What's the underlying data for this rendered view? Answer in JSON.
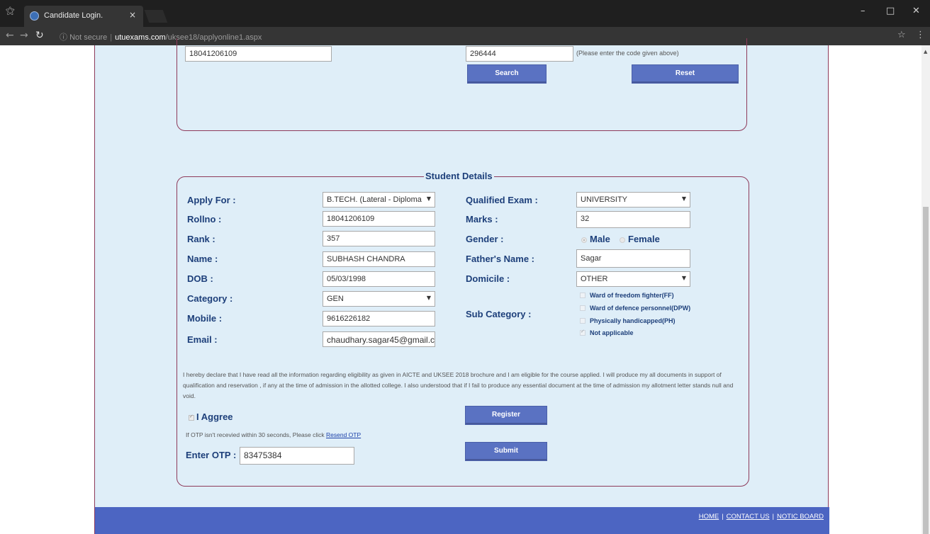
{
  "browser": {
    "tab_title": "Candidate Login.",
    "tab_close": "×",
    "url_insecure": "Not secure",
    "url_host": "utuexams.com",
    "url_path": "/uksee18/applyonline1.aspx"
  },
  "search_section": {
    "rollno_value": "18041206109",
    "code_value": "296444",
    "code_hint": "(Please enter the code given above)",
    "search_label": "Search",
    "reset_label": "Reset"
  },
  "student_details": {
    "legend": "Student Details",
    "left": {
      "apply_for": {
        "label": "Apply For :",
        "value": "B.TECH. (Lateral - Diploma"
      },
      "rollno": {
        "label": "Rollno :",
        "value": "18041206109"
      },
      "rank": {
        "label": "Rank :",
        "value": "357"
      },
      "name": {
        "label": "Name :",
        "value": "SUBHASH CHANDRA"
      },
      "dob": {
        "label": "DOB :",
        "value": "05/03/1998"
      },
      "category": {
        "label": "Category :",
        "value": "GEN"
      },
      "mobile": {
        "label": "Mobile :",
        "value": "9616226182"
      },
      "email": {
        "label": "Email :",
        "value": "chaudhary.sagar45@gmail.c"
      }
    },
    "right": {
      "qualified_exam": {
        "label": "Qualified Exam :",
        "value": "UNIVERSITY"
      },
      "marks": {
        "label": "Marks :",
        "value": "32"
      },
      "gender": {
        "label": "Gender :",
        "options": [
          "Male",
          "Female"
        ],
        "selected": "Male"
      },
      "fathers_name": {
        "label": "Father's Name :",
        "value": "Sagar"
      },
      "domicile": {
        "label": "Domicile :",
        "value": "OTHER"
      },
      "sub_category": {
        "label": "Sub Category :",
        "options": [
          {
            "label": "Ward of freedom fighter(FF)",
            "checked": false
          },
          {
            "label": "Ward of defence personnel(DPW)",
            "checked": false
          },
          {
            "label": "Physically handicapped(PH)",
            "checked": false
          },
          {
            "label": "Not applicable",
            "checked": true
          }
        ]
      }
    },
    "declaration": "I hereby declare that I have read all the information regarding eligibility as given in AICTE and UKSEE 2018 brochure and I am eligible for the course applied. I will produce my all documents in support of qualification and reservation , if any at the time of admission in the allotted college. I also understood that if I fail to produce any essential document at the time of admission my allotment letter stands null and void.",
    "agree_label": "I Aggree",
    "register_label": "Register",
    "otp_hint": "If OTP isn't recevied within 30 seconds, Please click",
    "resend_label": "Resend OTP",
    "otp_label": "Enter OTP :",
    "otp_value": "83475384",
    "submit_label": "Submit"
  },
  "footer": {
    "home": "HOME",
    "contact": "CONTACT US",
    "notice": "NOTIC BOARD",
    "separator": "|"
  }
}
